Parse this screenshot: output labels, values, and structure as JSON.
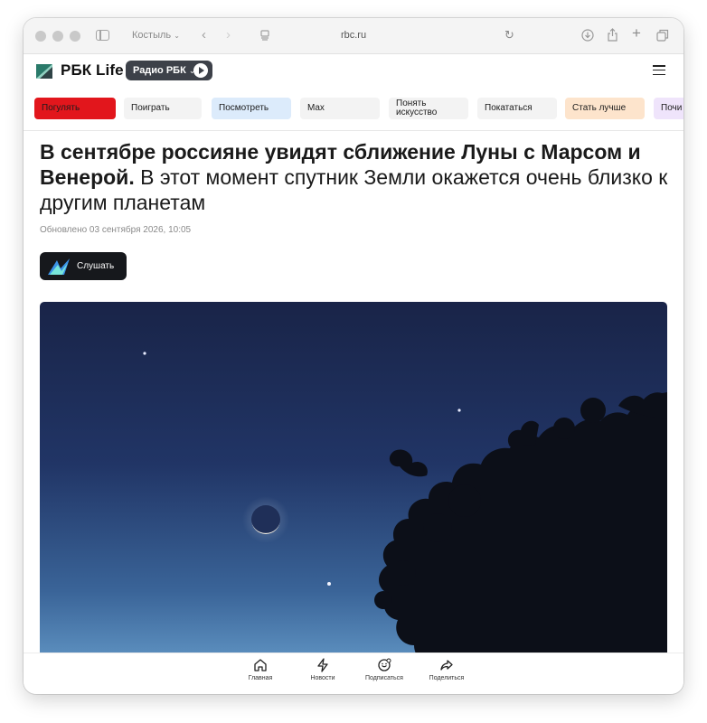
{
  "browser": {
    "profile_label": "Костыль",
    "url": "rbc.ru"
  },
  "site": {
    "brand": "РБК Life",
    "radio_label": "Радио РБК"
  },
  "rubrics": [
    {
      "label": "Погулять",
      "color": "#e2161c"
    },
    {
      "label": "Поиграть",
      "color": "#f3f3f3"
    },
    {
      "label": "Посмотреть",
      "color": "#dcebfb"
    },
    {
      "label": "Max",
      "color": "#f3f3f3"
    },
    {
      "label": "Понять искусство",
      "color": "#f3f3f3"
    },
    {
      "label": "Покататься",
      "color": "#f3f3f3"
    },
    {
      "label": "Стать лучше",
      "color": "#fde4cc"
    },
    {
      "label": "Почи",
      "color": "#efe4fb"
    }
  ],
  "article": {
    "headline_bold": "В сентябре россияне увидят сближение Луны с Марсом и Венерой.",
    "headline_rest": " В этот момент спутник Земли окажется очень близко к другим планетам",
    "updated": "Обновлено 03 сентября 2026, 10:05",
    "listen_label": "Слушать"
  },
  "tabbar": [
    {
      "label": "Главная",
      "icon": "home-icon"
    },
    {
      "label": "Новости",
      "icon": "lightning-icon"
    },
    {
      "label": "Подписаться",
      "icon": "subscribe-icon"
    },
    {
      "label": "Поделиться",
      "icon": "share-icon"
    }
  ],
  "colors": {
    "accent_red": "#e2161c",
    "dark_button": "#16181c",
    "sky_top": "#182447",
    "sky_bottom": "#5d8fbf"
  }
}
